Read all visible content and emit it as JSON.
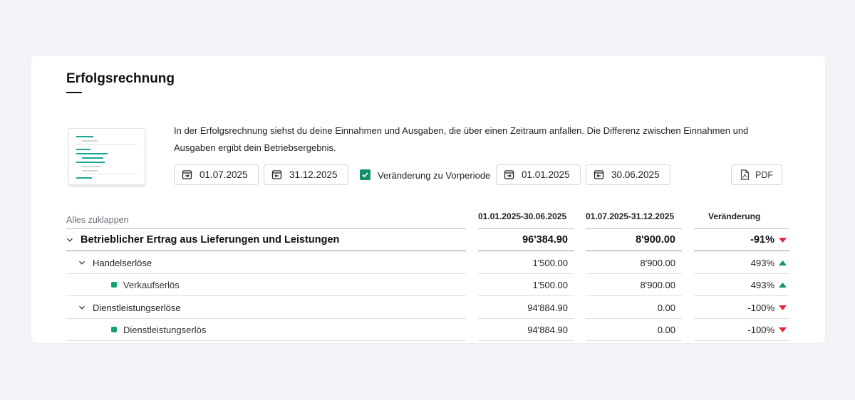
{
  "page": {
    "title": "Erfolgsrechnung",
    "description": "In der Erfolgsrechnung siehst du deine Einnahmen und Ausgaben, die über einen Zeitraum anfallen. Die Differenz zwischen Einnahmen und Ausgaben ergibt dein Betriebsergebnis."
  },
  "controls": {
    "date_from": "01.07.2025",
    "date_to": "31.12.2025",
    "compare_checked": true,
    "compare_label": "Veränderung zu Vorperiode",
    "prev_from": "01.01.2025",
    "prev_to": "30.06.2025",
    "pdf_label": "PDF"
  },
  "table": {
    "collapse_all": "Alles zuklappen",
    "columns": [
      "01.01.2025-30.06.2025",
      "01.07.2025-31.12.2025",
      "Veränderung"
    ],
    "rows": [
      {
        "label": "Betrieblicher Ertrag aus Lieferungen und Leistungen",
        "level": 0,
        "prev": "96'384.90",
        "curr": "8'900.00",
        "change": "-91%",
        "trend": "down"
      },
      {
        "label": "Handelserlöse",
        "level": 1,
        "prev": "1'500.00",
        "curr": "8'900.00",
        "change": "493%",
        "trend": "up"
      },
      {
        "label": "Verkaufserlös",
        "level": 2,
        "prev": "1'500.00",
        "curr": "8'900.00",
        "change": "493%",
        "trend": "up"
      },
      {
        "label": "Dienstleistungserlöse",
        "level": 1,
        "prev": "94'884.90",
        "curr": "0.00",
        "change": "-100%",
        "trend": "down"
      },
      {
        "label": "Dienstleistungserlös",
        "level": 2,
        "prev": "94'884.90",
        "curr": "0.00",
        "change": "-100%",
        "trend": "down"
      }
    ]
  },
  "colors": {
    "accent": "#13906a",
    "up": "#13906a",
    "down": "#e0263c"
  },
  "icons": {
    "date_from": "calendar-start-icon",
    "date_to": "calendar-end-icon",
    "pdf": "pdf-file-icon",
    "expand": "chevron-down-icon",
    "leaf": "green-square-bullet-icon"
  }
}
